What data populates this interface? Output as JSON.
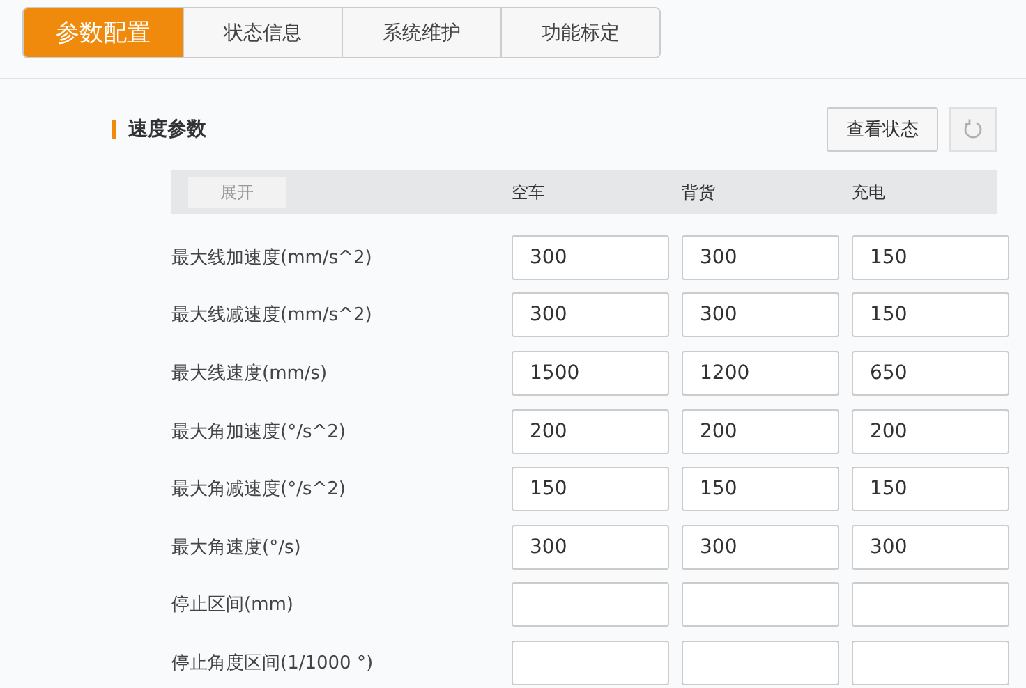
{
  "tabs": [
    {
      "label": "参数配置",
      "selected": true
    },
    {
      "label": "状态信息",
      "selected": false
    },
    {
      "label": "系统维护",
      "selected": false
    },
    {
      "label": "功能标定",
      "selected": false
    }
  ],
  "section": {
    "title": "速度参数",
    "status_button": "查看状态",
    "expand_button": "展开",
    "columns": [
      "空车",
      "背货",
      "充电"
    ],
    "rows": [
      {
        "label": "最大线加速度(mm/s^2)",
        "fields": [
          {
            "value": "300"
          },
          {
            "value": "300"
          },
          {
            "value": "150"
          }
        ]
      },
      {
        "label": "最大线减速度(mm/s^2)",
        "fields": [
          {
            "value": "300"
          },
          {
            "value": "300"
          },
          {
            "value": "150"
          }
        ]
      },
      {
        "label": "最大线速度(mm/s)",
        "fields": [
          {
            "value": "1500"
          },
          {
            "value": "1200"
          },
          {
            "value": "650"
          }
        ]
      },
      {
        "label": "最大角加速度(°/s^2)",
        "fields": [
          {
            "value": "200"
          },
          {
            "value": "200"
          },
          {
            "value": "200"
          }
        ]
      },
      {
        "label": "最大角减速度(°/s^2)",
        "fields": [
          {
            "value": "150"
          },
          {
            "value": "150"
          },
          {
            "value": "150"
          }
        ]
      },
      {
        "label": "最大角速度(°/s)",
        "fields": [
          {
            "value": "300"
          },
          {
            "value": "300"
          },
          {
            "value": "300"
          }
        ]
      },
      {
        "label": "停止区间(mm)"
      },
      {
        "label": "停止角度区间(1/1000 °)"
      }
    ]
  }
}
